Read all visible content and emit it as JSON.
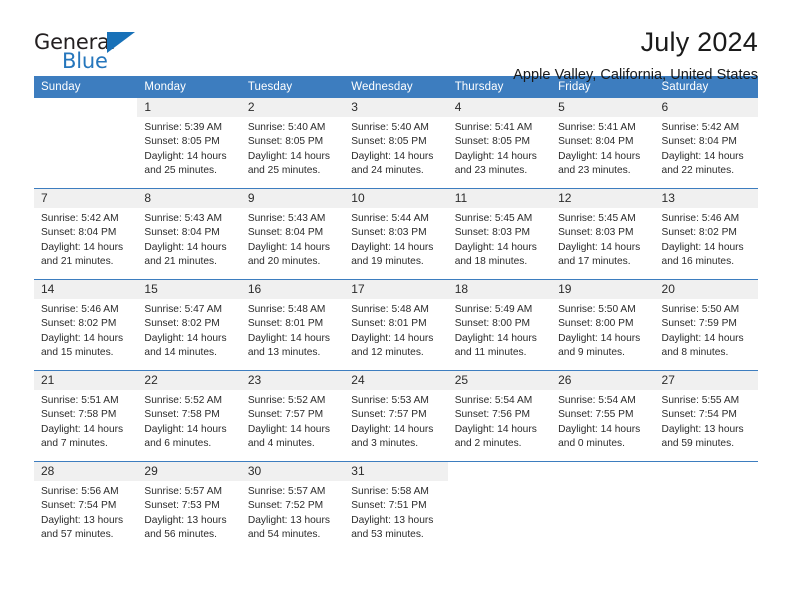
{
  "logo": {
    "word_top": "General",
    "word_bottom": "Blue",
    "triangle_color": "#1871b8",
    "text_color": "#231f20",
    "blue_color": "#2576bc"
  },
  "header": {
    "title": "July 2024",
    "subtitle": "Apple Valley, California, United States"
  },
  "theme": {
    "header_blue": "#3d7dbf",
    "daynum_bg": "#f0f0f0",
    "text": "#2b2b2b"
  },
  "calendar": {
    "weekday_headers": [
      "Sunday",
      "Monday",
      "Tuesday",
      "Wednesday",
      "Thursday",
      "Friday",
      "Saturday"
    ],
    "labels": {
      "sunrise": "Sunrise:",
      "sunset": "Sunset:",
      "daylight": "Daylight:"
    },
    "weeks": [
      [
        {
          "day": "",
          "sunrise": "",
          "sunset": "",
          "daylight": ""
        },
        {
          "day": "1",
          "sunrise": "Sunrise: 5:39 AM",
          "sunset": "Sunset: 8:05 PM",
          "daylight": "Daylight: 14 hours and 25 minutes."
        },
        {
          "day": "2",
          "sunrise": "Sunrise: 5:40 AM",
          "sunset": "Sunset: 8:05 PM",
          "daylight": "Daylight: 14 hours and 25 minutes."
        },
        {
          "day": "3",
          "sunrise": "Sunrise: 5:40 AM",
          "sunset": "Sunset: 8:05 PM",
          "daylight": "Daylight: 14 hours and 24 minutes."
        },
        {
          "day": "4",
          "sunrise": "Sunrise: 5:41 AM",
          "sunset": "Sunset: 8:05 PM",
          "daylight": "Daylight: 14 hours and 23 minutes."
        },
        {
          "day": "5",
          "sunrise": "Sunrise: 5:41 AM",
          "sunset": "Sunset: 8:04 PM",
          "daylight": "Daylight: 14 hours and 23 minutes."
        },
        {
          "day": "6",
          "sunrise": "Sunrise: 5:42 AM",
          "sunset": "Sunset: 8:04 PM",
          "daylight": "Daylight: 14 hours and 22 minutes."
        }
      ],
      [
        {
          "day": "7",
          "sunrise": "Sunrise: 5:42 AM",
          "sunset": "Sunset: 8:04 PM",
          "daylight": "Daylight: 14 hours and 21 minutes."
        },
        {
          "day": "8",
          "sunrise": "Sunrise: 5:43 AM",
          "sunset": "Sunset: 8:04 PM",
          "daylight": "Daylight: 14 hours and 21 minutes."
        },
        {
          "day": "9",
          "sunrise": "Sunrise: 5:43 AM",
          "sunset": "Sunset: 8:04 PM",
          "daylight": "Daylight: 14 hours and 20 minutes."
        },
        {
          "day": "10",
          "sunrise": "Sunrise: 5:44 AM",
          "sunset": "Sunset: 8:03 PM",
          "daylight": "Daylight: 14 hours and 19 minutes."
        },
        {
          "day": "11",
          "sunrise": "Sunrise: 5:45 AM",
          "sunset": "Sunset: 8:03 PM",
          "daylight": "Daylight: 14 hours and 18 minutes."
        },
        {
          "day": "12",
          "sunrise": "Sunrise: 5:45 AM",
          "sunset": "Sunset: 8:03 PM",
          "daylight": "Daylight: 14 hours and 17 minutes."
        },
        {
          "day": "13",
          "sunrise": "Sunrise: 5:46 AM",
          "sunset": "Sunset: 8:02 PM",
          "daylight": "Daylight: 14 hours and 16 minutes."
        }
      ],
      [
        {
          "day": "14",
          "sunrise": "Sunrise: 5:46 AM",
          "sunset": "Sunset: 8:02 PM",
          "daylight": "Daylight: 14 hours and 15 minutes."
        },
        {
          "day": "15",
          "sunrise": "Sunrise: 5:47 AM",
          "sunset": "Sunset: 8:02 PM",
          "daylight": "Daylight: 14 hours and 14 minutes."
        },
        {
          "day": "16",
          "sunrise": "Sunrise: 5:48 AM",
          "sunset": "Sunset: 8:01 PM",
          "daylight": "Daylight: 14 hours and 13 minutes."
        },
        {
          "day": "17",
          "sunrise": "Sunrise: 5:48 AM",
          "sunset": "Sunset: 8:01 PM",
          "daylight": "Daylight: 14 hours and 12 minutes."
        },
        {
          "day": "18",
          "sunrise": "Sunrise: 5:49 AM",
          "sunset": "Sunset: 8:00 PM",
          "daylight": "Daylight: 14 hours and 11 minutes."
        },
        {
          "day": "19",
          "sunrise": "Sunrise: 5:50 AM",
          "sunset": "Sunset: 8:00 PM",
          "daylight": "Daylight: 14 hours and 9 minutes."
        },
        {
          "day": "20",
          "sunrise": "Sunrise: 5:50 AM",
          "sunset": "Sunset: 7:59 PM",
          "daylight": "Daylight: 14 hours and 8 minutes."
        }
      ],
      [
        {
          "day": "21",
          "sunrise": "Sunrise: 5:51 AM",
          "sunset": "Sunset: 7:58 PM",
          "daylight": "Daylight: 14 hours and 7 minutes."
        },
        {
          "day": "22",
          "sunrise": "Sunrise: 5:52 AM",
          "sunset": "Sunset: 7:58 PM",
          "daylight": "Daylight: 14 hours and 6 minutes."
        },
        {
          "day": "23",
          "sunrise": "Sunrise: 5:52 AM",
          "sunset": "Sunset: 7:57 PM",
          "daylight": "Daylight: 14 hours and 4 minutes."
        },
        {
          "day": "24",
          "sunrise": "Sunrise: 5:53 AM",
          "sunset": "Sunset: 7:57 PM",
          "daylight": "Daylight: 14 hours and 3 minutes."
        },
        {
          "day": "25",
          "sunrise": "Sunrise: 5:54 AM",
          "sunset": "Sunset: 7:56 PM",
          "daylight": "Daylight: 14 hours and 2 minutes."
        },
        {
          "day": "26",
          "sunrise": "Sunrise: 5:54 AM",
          "sunset": "Sunset: 7:55 PM",
          "daylight": "Daylight: 14 hours and 0 minutes."
        },
        {
          "day": "27",
          "sunrise": "Sunrise: 5:55 AM",
          "sunset": "Sunset: 7:54 PM",
          "daylight": "Daylight: 13 hours and 59 minutes."
        }
      ],
      [
        {
          "day": "28",
          "sunrise": "Sunrise: 5:56 AM",
          "sunset": "Sunset: 7:54 PM",
          "daylight": "Daylight: 13 hours and 57 minutes."
        },
        {
          "day": "29",
          "sunrise": "Sunrise: 5:57 AM",
          "sunset": "Sunset: 7:53 PM",
          "daylight": "Daylight: 13 hours and 56 minutes."
        },
        {
          "day": "30",
          "sunrise": "Sunrise: 5:57 AM",
          "sunset": "Sunset: 7:52 PM",
          "daylight": "Daylight: 13 hours and 54 minutes."
        },
        {
          "day": "31",
          "sunrise": "Sunrise: 5:58 AM",
          "sunset": "Sunset: 7:51 PM",
          "daylight": "Daylight: 13 hours and 53 minutes."
        },
        {
          "day": "",
          "sunrise": "",
          "sunset": "",
          "daylight": ""
        },
        {
          "day": "",
          "sunrise": "",
          "sunset": "",
          "daylight": ""
        },
        {
          "day": "",
          "sunrise": "",
          "sunset": "",
          "daylight": ""
        }
      ]
    ]
  }
}
